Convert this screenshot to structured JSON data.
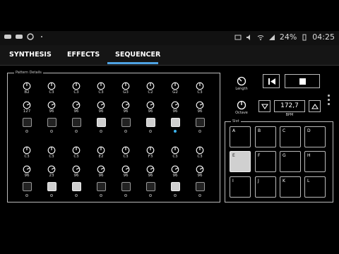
{
  "status_bar": {
    "battery": "24%",
    "time": "04:25",
    "left_icons": [
      "gamepad-icon",
      "gamepad-icon",
      "settings-circle-icon",
      "dot-icon"
    ],
    "right_icons": [
      "cast-icon",
      "mute-icon",
      "wifi-icon",
      "signal-icon",
      "battery-icon"
    ]
  },
  "tabs": [
    {
      "label": "SYNTHESIS",
      "active": false
    },
    {
      "label": "EFFECTS",
      "active": false
    },
    {
      "label": "SEQUENCER",
      "active": true
    }
  ],
  "accent_color": "#4fa3e3",
  "pattern": {
    "title": "Pattern Details",
    "rows": [
      {
        "notes": [
          "B2",
          "C3",
          "C3",
          "C3",
          "G3",
          "C2",
          "G2",
          "C3"
        ],
        "velocities": [
          "127",
          "96",
          "96",
          "96",
          "96",
          "96",
          "96",
          "96"
        ],
        "steps_on": [
          false,
          false,
          false,
          true,
          false,
          true,
          true,
          false
        ],
        "active_led": 6
      },
      {
        "notes": [
          "C3",
          "C3",
          "C3",
          "E2",
          "C3",
          "F3",
          "C3",
          "C3"
        ],
        "velocities": [
          "96",
          "23",
          "96",
          "96",
          "96",
          "96",
          "96",
          "96"
        ],
        "steps_on": [
          false,
          true,
          true,
          false,
          false,
          false,
          true,
          false
        ],
        "active_led": -1
      }
    ]
  },
  "controls": {
    "length_label": "Length",
    "octave_label": "Octave",
    "bpm_value": "172,7",
    "bpm_label": "BPM"
  },
  "slot": {
    "title": "Slot",
    "pads": [
      "A",
      "B",
      "C",
      "D",
      "E",
      "F",
      "G",
      "H",
      "I",
      "J",
      "K",
      "L"
    ],
    "selected": "E"
  }
}
